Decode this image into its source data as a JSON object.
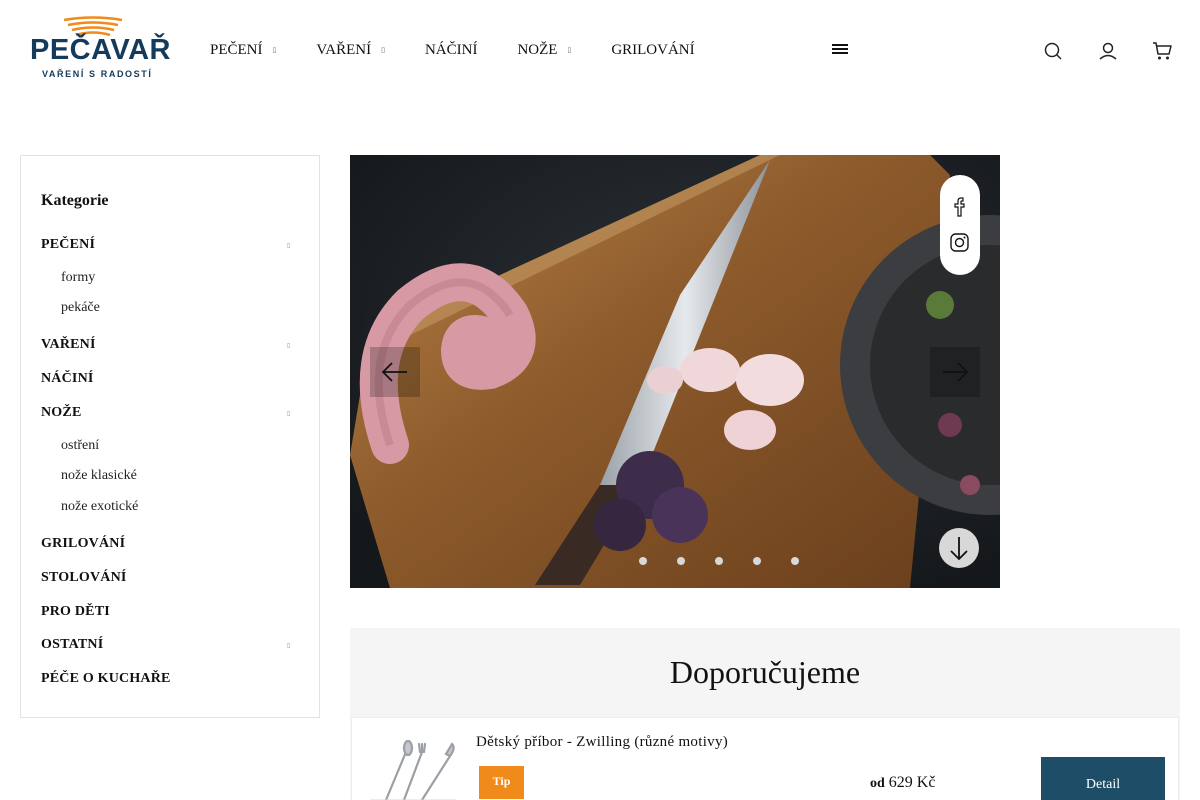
{
  "brand": {
    "name": "PEČAVAŘ",
    "tagline": "VAŘENÍ S RADOSTÍ",
    "colors": {
      "navy": "#143a5c",
      "orange": "#f08a1a",
      "button": "#1e4d67"
    }
  },
  "nav": {
    "items": [
      {
        "label": "PEČENÍ",
        "has_submenu": true
      },
      {
        "label": "VAŘENÍ",
        "has_submenu": true
      },
      {
        "label": "NÁČINÍ",
        "has_submenu": false
      },
      {
        "label": "NOŽE",
        "has_submenu": true
      },
      {
        "label": "GRILOVÁNÍ",
        "has_submenu": false
      }
    ],
    "caret_glyph": "▯",
    "icons": [
      "menu-icon",
      "search-icon",
      "user-icon",
      "cart-icon"
    ]
  },
  "sidebar": {
    "title": "Kategorie",
    "categories": [
      {
        "label": "PEČENÍ",
        "expandable": true,
        "children": [
          "formy",
          "pekáče"
        ]
      },
      {
        "label": "VAŘENÍ",
        "expandable": true,
        "children": []
      },
      {
        "label": "NÁČINÍ",
        "expandable": false,
        "children": []
      },
      {
        "label": "NOŽE",
        "expandable": true,
        "children": [
          "ostření",
          "nože klasické",
          "nože exotické"
        ]
      },
      {
        "label": "GRILOVÁNÍ",
        "expandable": false,
        "children": []
      },
      {
        "label": "STOLOVÁNÍ",
        "expandable": false,
        "children": []
      },
      {
        "label": "PRO DĚTI",
        "expandable": false,
        "children": []
      },
      {
        "label": "OSTATNÍ",
        "expandable": true,
        "children": []
      },
      {
        "label": "PÉČE O KUCHAŘE",
        "expandable": false,
        "children": []
      }
    ]
  },
  "slider": {
    "slide_count": 5,
    "icons": [
      "arrow-left-icon",
      "arrow-right-icon",
      "arrow-down-icon",
      "facebook-icon",
      "instagram-icon"
    ]
  },
  "recommended": {
    "title": "Doporučujeme",
    "products": [
      {
        "name": "Dětský příbor - Zwilling (různé motivy)",
        "badge": "Tip",
        "price_prefix": "od",
        "price": "629 Kč",
        "button": "Detail"
      }
    ]
  }
}
